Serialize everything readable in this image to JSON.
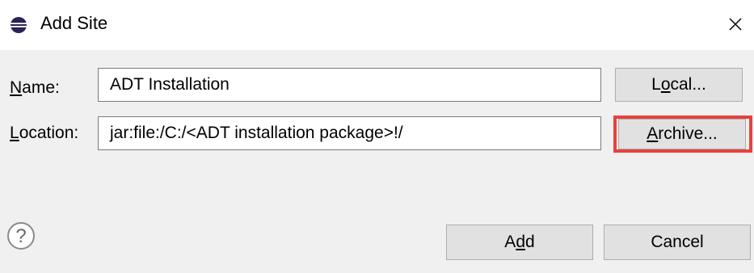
{
  "window": {
    "title": "Add Site",
    "close_glyph": "×",
    "icon": "eclipse-icon"
  },
  "form": {
    "name": {
      "label_pre": "",
      "label_mnemonic": "N",
      "label_post": "ame:",
      "value": "ADT Installation"
    },
    "location": {
      "label_pre": "",
      "label_mnemonic": "L",
      "label_post": "ocation:",
      "value": "jar:file:/C:/<ADT installation package>!/"
    }
  },
  "buttons": {
    "local": {
      "pre": "L",
      "mnemonic": "o",
      "post": "cal..."
    },
    "archive": {
      "pre": "",
      "mnemonic": "A",
      "post": "rchive..."
    },
    "add": {
      "pre": "A",
      "mnemonic": "d",
      "post": "d"
    },
    "cancel": {
      "label": "Cancel"
    }
  },
  "help": {
    "icon": "help-icon",
    "glyph": "?"
  },
  "colors": {
    "highlight": "#e8413c",
    "panel_bg": "#f0f0f0",
    "button_bg": "#e1e1e1"
  }
}
